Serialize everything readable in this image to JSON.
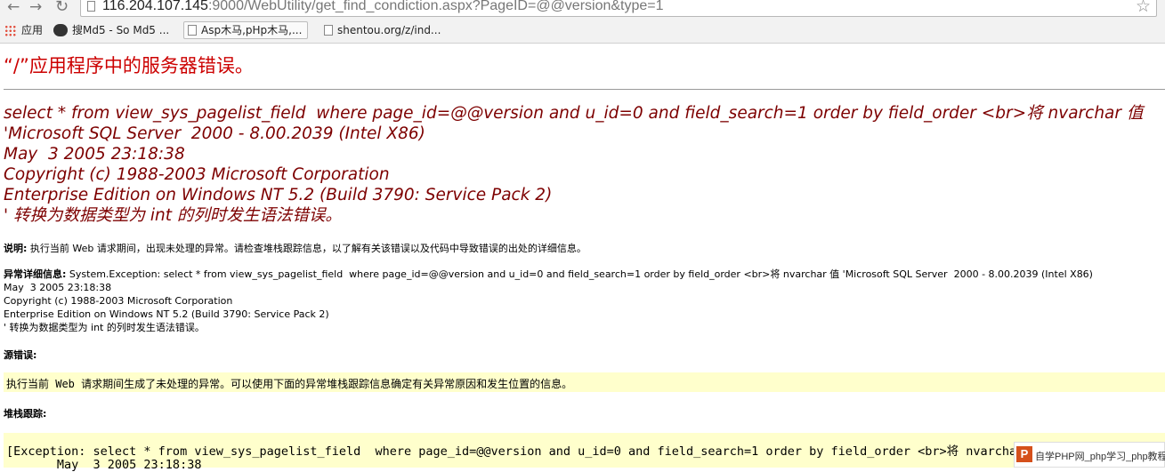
{
  "browser": {
    "url_host": "116.204.107.145",
    "url_rest": ":9000/WebUtility/get_find_condiction.aspx?PageID=@@version&type=1",
    "bookmarks": [
      {
        "label": "应用",
        "icon": "apps-grid-icon"
      },
      {
        "label": "搜Md5 - So Md5 ...",
        "icon": "md5-site-icon"
      },
      {
        "label": "Asp木马,pHp木马,...",
        "icon": "page-icon"
      },
      {
        "label": "shentou.org/z/ind...",
        "icon": "page-icon"
      }
    ]
  },
  "page": {
    "title": "“/”应用程序中的服务器错误。",
    "error_lines": [
      "select * from view_sys_pagelist_field  where page_id=@@version and u_id=0 and field_search=1 order by field_order <br>将 nvarchar 值",
      "'Microsoft SQL Server  2000 - 8.00.2039 (Intel X86)",
      "May  3 2005 23:18:38",
      "Copyright (c) 1988-2003 Microsoft Corporation",
      "Enterprise Edition on Windows NT 5.2 (Build 3790: Service Pack 2)",
      "' 转换为数据类型为 int 的列时发生语法错误。"
    ],
    "description": {
      "label": "说明:",
      "text": " 执行当前 Web 请求期间，出现未处理的异常。请检查堆栈跟踪信息，以了解有关该错误以及代码中导致错误的出处的详细信息。"
    },
    "exception_details": {
      "label": "异常详细信息:",
      "first_line": " System.Exception: select * from view_sys_pagelist_field  where page_id=@@version and u_id=0 and field_search=1 order by field_order <br>将 nvarchar 值 'Microsoft SQL Server  2000 - 8.00.2039 (Intel X86)",
      "rest": "May  3 2005 23:18:38\nCopyright (c) 1988-2003 Microsoft Corporation\nEnterprise Edition on Windows NT 5.2 (Build 3790: Service Pack 2)\n' 转换为数据类型为 int 的列时发生语法错误。"
    },
    "source_error": {
      "heading": "源错误:",
      "text": "执行当前 Web 请求期间生成了未处理的异常。可以使用下面的异常堆栈跟踪信息确定有关异常原因和发生位置的信息。"
    },
    "stack_trace": {
      "heading": "堆栈跟踪:",
      "line1": "[Exception: select * from view_sys_pagelist_field  where page_id=@@version and u_id=0 and field_search=1 order by field_order <br>将 nvarchar",
      "line2": "       May  3 2005 23:18:38"
    },
    "watermark": {
      "logo": "P",
      "text": "自学PHP网_php学习_php教程"
    }
  }
}
